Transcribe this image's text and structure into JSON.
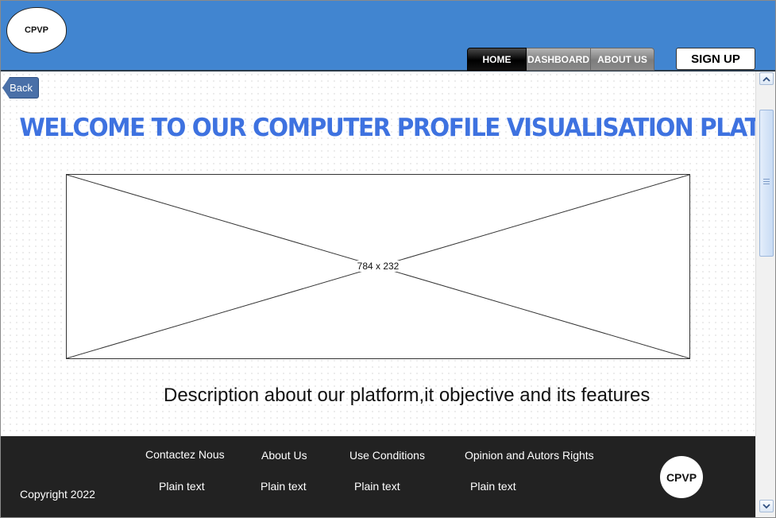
{
  "header": {
    "logo_text": "CPVP",
    "nav": [
      {
        "label": "HOME",
        "active": true
      },
      {
        "label": "DASHBOARD",
        "active": false
      },
      {
        "label": "ABOUT US",
        "active": false
      }
    ],
    "signup_label": "SIGN UP",
    "bg_color": "#4185d0"
  },
  "content": {
    "back_label": "Back",
    "welcome_title": "WELCOME TO OUR COMPUTER  PROFILE VISUALISATION PLATFORM",
    "placeholder_label": "784 x 232",
    "description": "Description about our platform,it objective  and its features",
    "title_color": "#3e72e0"
  },
  "footer": {
    "links": [
      "Contactez Nous",
      "About Us",
      "Use Conditions",
      "Opinion and Autors Rights"
    ],
    "plain_texts": [
      "Plain text",
      "Plain text",
      "Plain text",
      "Plain text"
    ],
    "copyright": "Copyright 2022",
    "logo_text": "CPVP",
    "bg_color": "#222222"
  },
  "icons": {
    "scroll_up": "chevron-up-icon",
    "scroll_down": "chevron-down-icon",
    "back": "back-arrow-button"
  }
}
